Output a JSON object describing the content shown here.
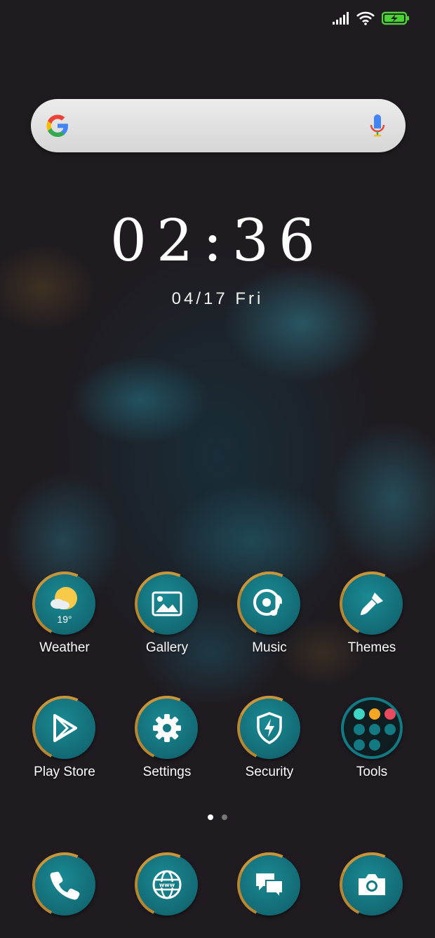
{
  "status_bar": {
    "signal_icon": "signal-icon",
    "wifi_icon": "wifi-icon",
    "battery_icon": "battery-charging-icon",
    "battery_color": "#4cd137"
  },
  "search": {
    "logo": "google-logo",
    "mic_icon": "mic-icon"
  },
  "clock": {
    "time": "02:36",
    "date": "04/17  Fri"
  },
  "apps_row1": [
    {
      "label": "Weather",
      "icon": "weather-icon",
      "temp": "19°"
    },
    {
      "label": "Gallery",
      "icon": "gallery-icon"
    },
    {
      "label": "Music",
      "icon": "music-icon"
    },
    {
      "label": "Themes",
      "icon": "brush-icon"
    }
  ],
  "apps_row2": [
    {
      "label": "Play Store",
      "icon": "play-store-icon"
    },
    {
      "label": "Settings",
      "icon": "gear-icon"
    },
    {
      "label": "Security",
      "icon": "shield-icon"
    },
    {
      "label": "Tools",
      "icon": "folder-icon"
    }
  ],
  "page_indicator": {
    "pages": 2,
    "active": 0
  },
  "dock": [
    {
      "icon": "phone-icon"
    },
    {
      "icon": "browser-icon"
    },
    {
      "icon": "messages-icon"
    },
    {
      "icon": "camera-icon"
    }
  ],
  "colors": {
    "icon_teal": "#137a84",
    "icon_ring": "#c8953a",
    "background": "#1f1b20"
  }
}
